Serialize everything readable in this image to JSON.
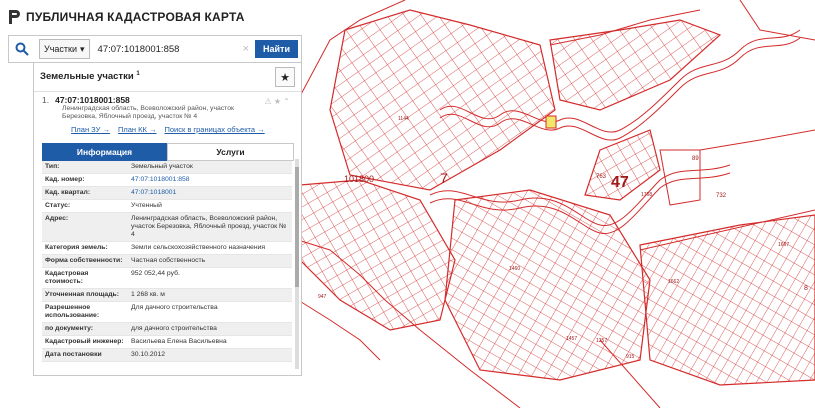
{
  "header": {
    "title": "ПУБЛИЧНАЯ КАДАСТРОВАЯ КАРТА"
  },
  "search": {
    "type": "Участки",
    "query": "47:07:1018001:858",
    "clear": "×",
    "button": "Найти"
  },
  "panel": {
    "title": "Земельные участки",
    "title_sup": "1",
    "result": {
      "index": "1.",
      "cad_number": "47:07:1018001:858",
      "address": "Ленинградская область, Всеволожский район, участок Березовка, Яблочный проезд, участок № 4",
      "links": [
        "План ЗУ →",
        "План КК →",
        "Поиск в границах объекта →"
      ]
    },
    "tabs": [
      "Информация",
      "Услуги"
    ],
    "rows": [
      {
        "label": "Тип:",
        "value": "Земельный участок"
      },
      {
        "label": "Кад. номер:",
        "value": "47:07:1018001:858",
        "link": true
      },
      {
        "label": "Кад. квартал:",
        "value": "47:07:1018001",
        "link": true
      },
      {
        "label": "Статус:",
        "value": "Учтенный"
      },
      {
        "label": "Адрес:",
        "value": "Ленинградская область, Всеволожский район, участок Березовка, Яблочный проезд, участок № 4"
      },
      {
        "label": "Категория земель:",
        "value": "Земли сельскохозяйственного назначения"
      },
      {
        "label": "Форма собственности:",
        "value": "Частная собственность"
      },
      {
        "label": "Кадастровая стоимость:",
        "value": "952 052,44 руб."
      },
      {
        "label": "Уточненная площадь:",
        "value": "1 268 кв. м"
      },
      {
        "label": "Разрешенное использование:",
        "value": "Для дачного строительства"
      },
      {
        "label": "по документу:",
        "value": "для дачного строительства"
      },
      {
        "label": "Кадастровый инженер:",
        "value": "Васильева Елена Васильевна"
      },
      {
        "label": "Дата постановки",
        "value": "30.10.2012"
      }
    ]
  },
  "map": {
    "labels": {
      "l101800": "101800",
      "l7": "7",
      "l47": "47",
      "l763": "763",
      "l89": "89",
      "l732": "732",
      "l1768": "1768",
      "l1144": "1144",
      "l1460": "1460",
      "l947": "947",
      "l1457": "1457",
      "l1357": "1357",
      "l915": "915",
      "l1662": "1662",
      "l1667": "1667",
      "l8": "8"
    }
  },
  "colors": {
    "accent": "#1e5ca8",
    "map_lines": "#d42b2b",
    "highlight": "#f2e76a"
  }
}
